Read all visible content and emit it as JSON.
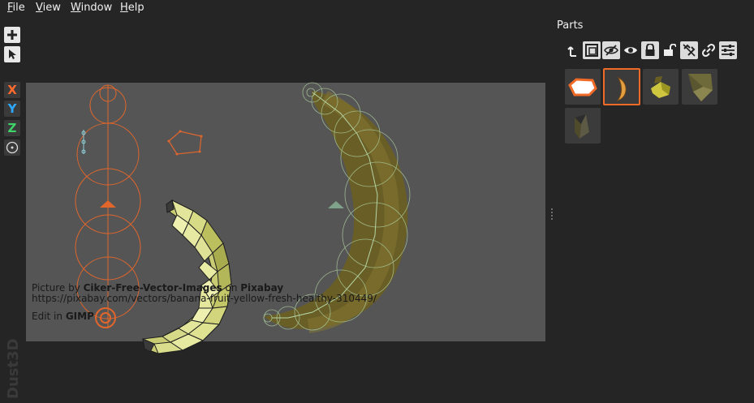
{
  "menu": {
    "file": "File",
    "view": "View",
    "window": "Window",
    "help": "Help"
  },
  "tools": {
    "add_icon": "plus-icon",
    "select_icon": "pointer-icon",
    "x_label": "X",
    "y_label": "Y",
    "z_label": "Z",
    "info_icon": "info-icon",
    "x_color": "#ff6a2e",
    "y_color": "#2ea8ff",
    "z_color": "#3ed46a"
  },
  "credit": {
    "line1_prefix": "Picture by ",
    "line1_author": "Ciker-Free-Vector-Images",
    "line1_mid": " on ",
    "line1_site": "Pixabay",
    "line2": "https://pixabay.com/vectors/banana-fruit-yellow-fresh-healthy-310449/",
    "line3_prefix": "Edit in ",
    "line3_app": "GIMP"
  },
  "watermark": "Dust3D",
  "parts": {
    "title": "Parts",
    "toolbar": [
      {
        "icon": "up-arrow-icon",
        "active": false
      },
      {
        "icon": "mirror-frame-icon",
        "active": true
      },
      {
        "icon": "eye-hidden-icon",
        "active": true
      },
      {
        "icon": "eye-icon",
        "active": false
      },
      {
        "icon": "lock-icon",
        "active": true
      },
      {
        "icon": "unlock-icon",
        "active": false
      },
      {
        "icon": "unlink-icon",
        "active": true
      },
      {
        "icon": "link-icon",
        "active": false
      },
      {
        "icon": "settings-sliders-icon",
        "active": true
      }
    ],
    "items": [
      {
        "name": "orange-outline-part",
        "selected": false
      },
      {
        "name": "banana-part",
        "selected": true
      },
      {
        "name": "yellow-block-part",
        "selected": false
      },
      {
        "name": "olive-block-part",
        "selected": false
      },
      {
        "name": "dark-block-part",
        "selected": false
      }
    ]
  },
  "colors": {
    "accent": "#f06a28",
    "node_green": "#9fd79a"
  }
}
